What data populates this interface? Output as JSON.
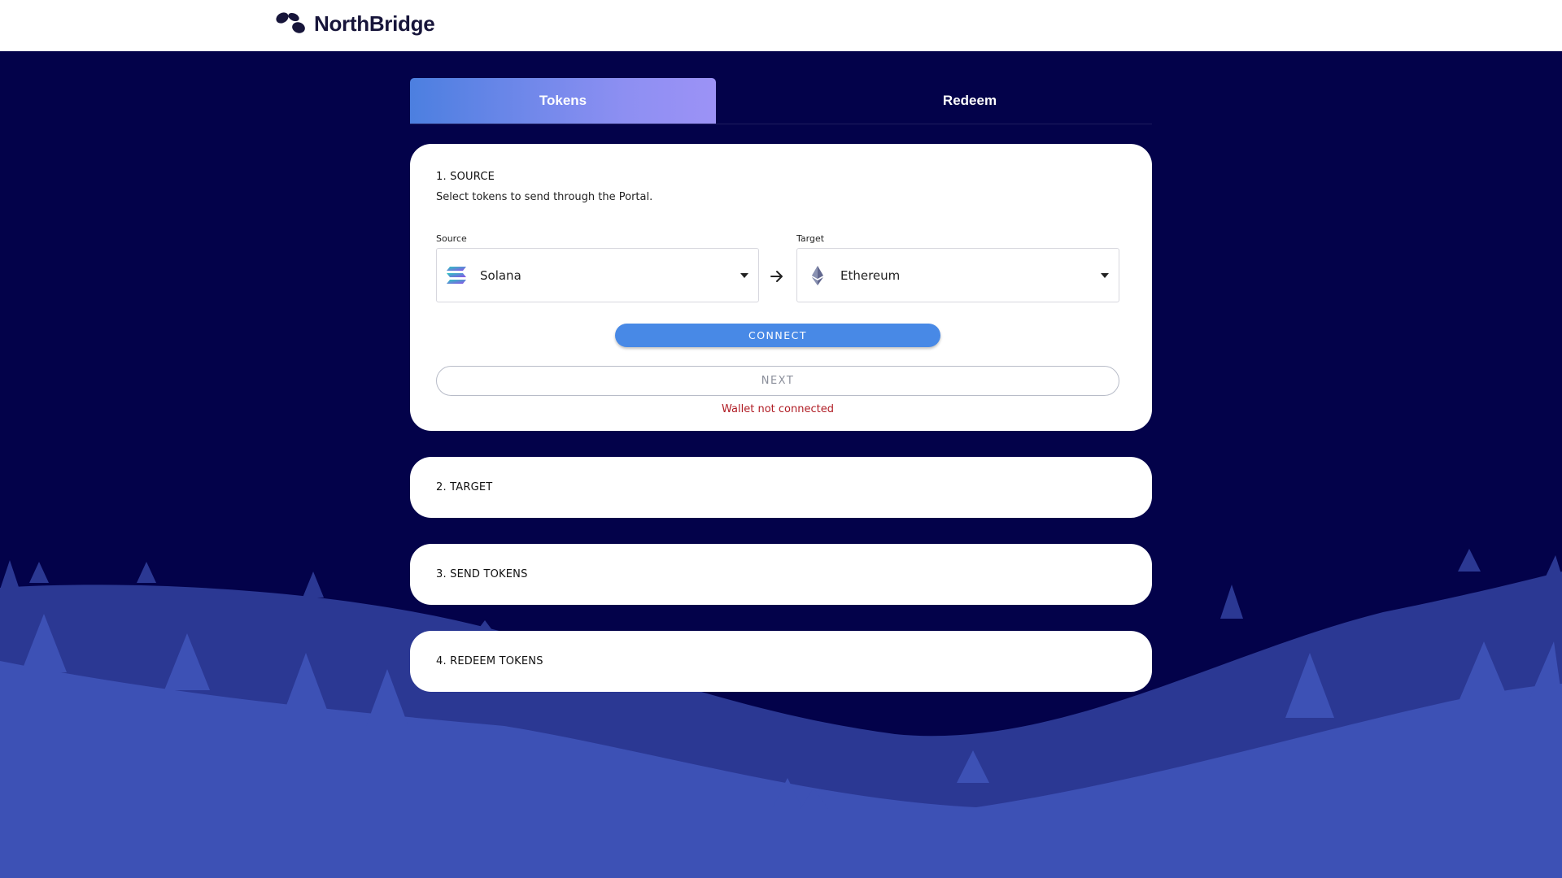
{
  "brand": {
    "name": "NorthBridge"
  },
  "tabs": [
    {
      "label": "Tokens",
      "active": true
    },
    {
      "label": "Redeem",
      "active": false
    }
  ],
  "steps": [
    {
      "title": "1. SOURCE",
      "description": "Select tokens to send through the Portal.",
      "source": {
        "label": "Source",
        "value": "Solana",
        "icon": "solana-icon"
      },
      "target": {
        "label": "Target",
        "value": "Ethereum",
        "icon": "ethereum-icon"
      },
      "connect_label": "CONNECT",
      "next_label": "NEXT",
      "error": "Wallet not connected"
    },
    {
      "title": "2. TARGET"
    },
    {
      "title": "3. SEND TOKENS"
    },
    {
      "title": "4. REDEEM TOKENS"
    }
  ],
  "colors": {
    "background": "#03024a",
    "accent": "#4889e6",
    "error": "#b01c24",
    "hills_back": "#2b3893",
    "hills_front": "#3d51b5"
  }
}
